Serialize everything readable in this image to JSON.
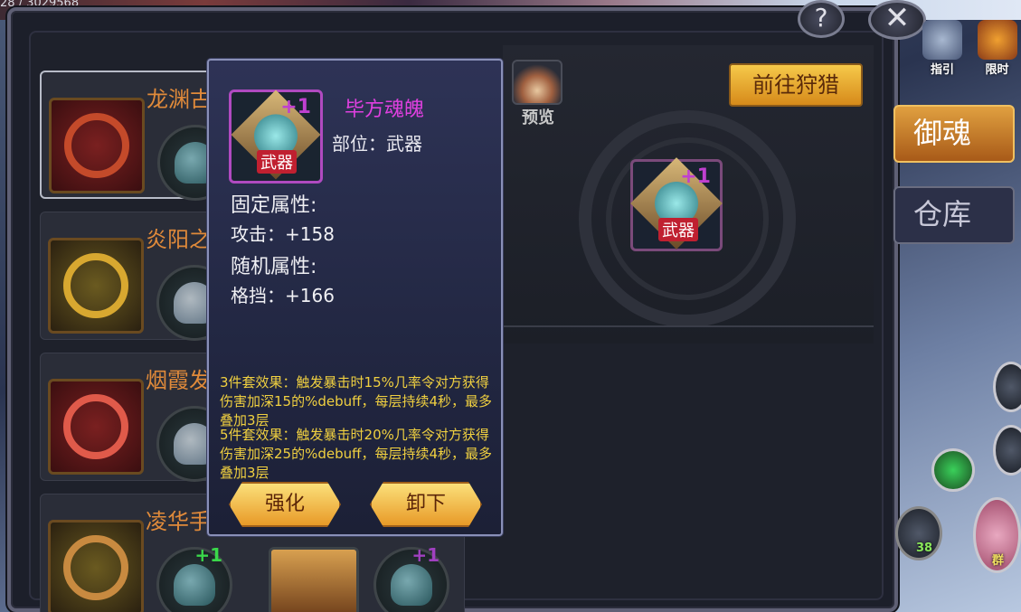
{
  "top_counter": "28 / 3029568",
  "header": {
    "help_label": "?",
    "close_label": "✕"
  },
  "hud": {
    "guide_label": "指引",
    "limited_label": "限时",
    "count_badge": "38",
    "bottom_right_label": "群"
  },
  "right_panel": {
    "preview_label": "预览",
    "goto_hunt_label": "前往狩猎",
    "equipped": {
      "plus": "+1",
      "tag": "武器"
    }
  },
  "side_tabs": [
    {
      "label": "御魂",
      "active": true
    },
    {
      "label": "仓库",
      "active": false
    }
  ],
  "sets": [
    {
      "title": "龙渊古",
      "piece_plus": "+"
    },
    {
      "title": "炎阳之",
      "piece_plus": ""
    },
    {
      "title": "烟霞发",
      "piece_plus": ""
    },
    {
      "title": "凌华手",
      "piece_plus": "+1",
      "piece2_plus": "+1"
    }
  ],
  "tooltip": {
    "item_name": "毕方魂魄",
    "item_plus": "+1",
    "item_tag": "武器",
    "slot_text": "部位：武器",
    "fixed_title": "固定属性:",
    "fixed_stat": "攻击：+158",
    "random_title": "随机属性:",
    "random_stat": "格挡：+166",
    "set_3": "3件套效果：触发暴击时15%几率令对方获得伤害加深15的%debuff，每层持续4秒，最多叠加3层",
    "set_5": "5件套效果：触发暴击时20%几率令对方获得伤害加深25的%debuff，每层持续4秒，最多叠加3层",
    "enhance_label": "强化",
    "unequip_label": "卸下"
  },
  "colors": {
    "item_name": "#e040e0",
    "set_effect": "#f0d040",
    "set_title": "#e08a3a",
    "button_gold": "#f6c94a"
  }
}
